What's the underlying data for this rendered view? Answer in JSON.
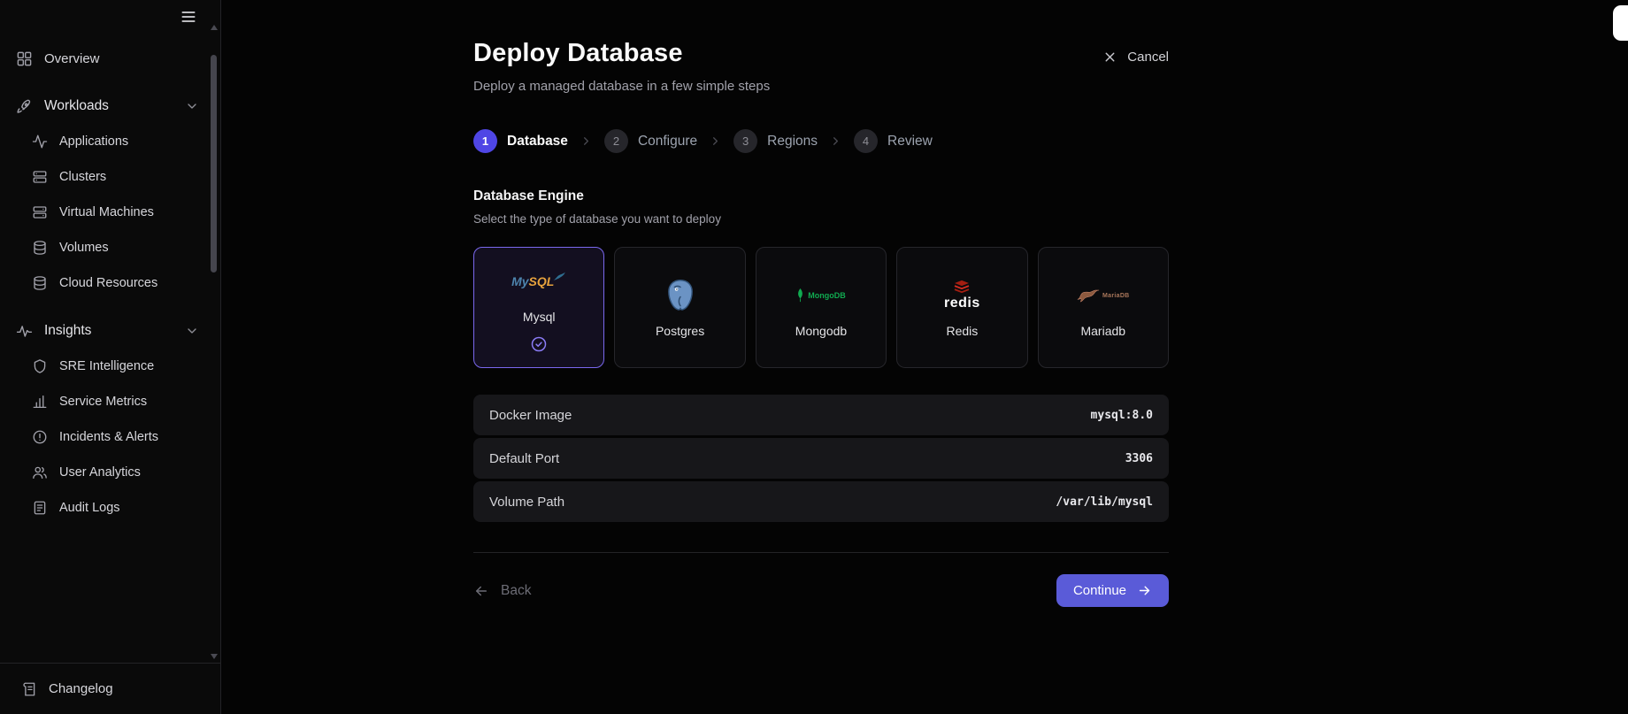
{
  "sidebar": {
    "items": [
      {
        "label": "Overview"
      },
      {
        "label": "Workloads"
      },
      {
        "label": "Applications"
      },
      {
        "label": "Clusters"
      },
      {
        "label": "Virtual Machines"
      },
      {
        "label": "Volumes"
      },
      {
        "label": "Cloud Resources"
      },
      {
        "label": "Insights"
      },
      {
        "label": "SRE Intelligence"
      },
      {
        "label": "Service Metrics"
      },
      {
        "label": "Incidents & Alerts"
      },
      {
        "label": "User Analytics"
      },
      {
        "label": "Audit Logs"
      }
    ],
    "footer_item": {
      "label": "Changelog"
    }
  },
  "wizard": {
    "title": "Deploy Database",
    "subtitle": "Deploy a managed database in a few simple steps",
    "cancel_label": "Cancel",
    "steps": [
      {
        "number": "1",
        "label": "Database",
        "active": true
      },
      {
        "number": "2",
        "label": "Configure",
        "active": false
      },
      {
        "number": "3",
        "label": "Regions",
        "active": false
      },
      {
        "number": "4",
        "label": "Review",
        "active": false
      }
    ],
    "engine": {
      "heading": "Database Engine",
      "subheading": "Select the type of database you want to deploy",
      "options": [
        {
          "label": "Mysql",
          "selected": true
        },
        {
          "label": "Postgres",
          "selected": false
        },
        {
          "label": "Mongodb",
          "selected": false
        },
        {
          "label": "Redis",
          "selected": false
        },
        {
          "label": "Mariadb",
          "selected": false
        }
      ]
    },
    "details": [
      {
        "label": "Docker Image",
        "value": "mysql:8.0"
      },
      {
        "label": "Default Port",
        "value": "3306"
      },
      {
        "label": "Volume Path",
        "value": "/var/lib/mysql"
      }
    ],
    "back_label": "Back",
    "continue_label": "Continue"
  },
  "logos": {
    "mysql": {
      "my": "My",
      "sql": "SQL"
    },
    "mongodb": "MongoDB",
    "redis": "redis",
    "mariadb": "MariaDB"
  },
  "colors": {
    "accent": "#5a5bd8",
    "step_active": "#4f46e5",
    "selected_card_border": "#7a68ee"
  }
}
